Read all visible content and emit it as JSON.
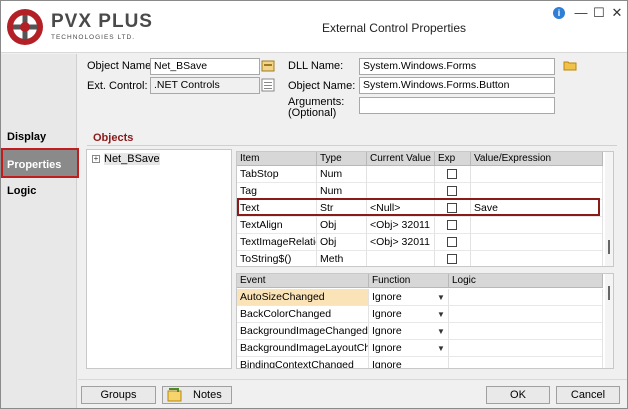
{
  "window": {
    "title": "External Control Properties",
    "logo_text": "PVX PLUS",
    "logo_sub": "TECHNOLOGIES LTD.",
    "info_icon": "i",
    "minimize_icon": "—",
    "maximize_icon": "☐",
    "close_icon": "✕"
  },
  "sidebar": {
    "items": [
      {
        "label": "Display"
      },
      {
        "label": "Properties"
      },
      {
        "label": "Logic"
      }
    ],
    "active": "Properties",
    "accent": "#c01e1e"
  },
  "form": {
    "object_name_label": "Object Name:",
    "object_name_value": "Net_BSave",
    "ext_control_label": "Ext. Control:",
    "ext_control_value": ".NET Controls",
    "dll_name_label": "DLL Name:",
    "dll_name_value": "System.Windows.Forms",
    "object_name2_label": "Object Name:",
    "object_name2_value": "System.Windows.Forms.Button",
    "arguments_label": "Arguments:",
    "arguments_sub": "(Optional)",
    "arguments_value": ""
  },
  "objects": {
    "title": "Objects",
    "tree_expander": "+",
    "tree_item": "Net_BSave"
  },
  "props_grid": {
    "columns": [
      "Item",
      "Type",
      "Current Value",
      "Exp",
      "Value/Expression"
    ],
    "rows": [
      {
        "item": "TabStop",
        "type": "Num",
        "current": "",
        "exp": false,
        "value": ""
      },
      {
        "item": "Tag",
        "type": "Num",
        "current": "",
        "exp": false,
        "value": ""
      },
      {
        "item": "Text",
        "type": "Str",
        "current": "<Null>",
        "exp": false,
        "value": "Save"
      },
      {
        "item": "TextAlign",
        "type": "Obj",
        "current": "<Obj> 32011",
        "exp": false,
        "value": ""
      },
      {
        "item": "TextImageRelation",
        "type": "Obj",
        "current": "<Obj> 32011",
        "exp": false,
        "value": ""
      },
      {
        "item": "ToString$()",
        "type": "Meth",
        "current": "",
        "exp": false,
        "value": ""
      }
    ],
    "highlight_color": "#8b1a1a"
  },
  "events_grid": {
    "columns": [
      "Event",
      "Function",
      "Logic"
    ],
    "rows": [
      {
        "event": "AutoSizeChanged",
        "function": "Ignore",
        "logic": "",
        "selected": true
      },
      {
        "event": "BackColorChanged",
        "function": "Ignore",
        "logic": ""
      },
      {
        "event": "BackgroundImageChanged",
        "function": "Ignore",
        "logic": ""
      },
      {
        "event": "BackgroundImageLayoutChanged",
        "function": "Ignore",
        "logic": ""
      },
      {
        "event": "BindingContextChanged",
        "function": "Ignore",
        "logic": ""
      }
    ],
    "selected_color": "#fbe3b8"
  },
  "bottom": {
    "groups_label": "Groups",
    "notes_label": "Notes",
    "ok_label": "OK",
    "cancel_label": "Cancel"
  }
}
